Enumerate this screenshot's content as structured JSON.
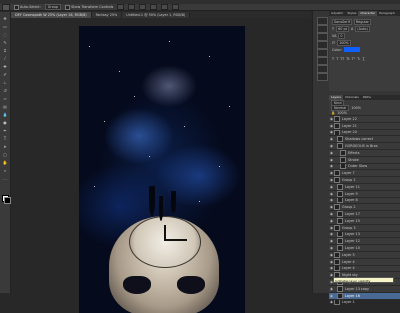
{
  "options_bar": {
    "auto_select_label": "Auto-Select:",
    "auto_select_value": "Group",
    "show_transform_label": "Show Transform Controls"
  },
  "doc_tabs": [
    {
      "label": "DEY Cosmopath W 25% (Layer 16, RGB/8)",
      "active": true
    },
    {
      "label": "Fantasy 25%",
      "active": false
    },
    {
      "label": "Untitled-1 @ 50% (Layer 1, RGB/8)",
      "active": false
    }
  ],
  "panel_tabs_top": [
    "Adjustm",
    "Styles",
    "Character",
    "Paragraph"
  ],
  "character": {
    "font_family": "SansSerif",
    "font_style": "Regular",
    "size": "60 pt",
    "leading": "(Auto)",
    "tracking": "0",
    "scale": "100%",
    "color_label": "Color:"
  },
  "layers_panel": {
    "tabs": [
      "Layers",
      "Channels",
      "Paths"
    ],
    "kind_label": "Kind",
    "blend_mode": "Normal",
    "opacity": "100%",
    "fill": "100%",
    "items": [
      {
        "name": "Layer 22",
        "indent": 0,
        "selected": false
      },
      {
        "name": "Layer 21",
        "indent": 0,
        "selected": false
      },
      {
        "name": "Layer 20",
        "indent": 0,
        "selected": false
      },
      {
        "name": "Shadows correct",
        "indent": 1,
        "selected": false
      },
      {
        "name": "GORGEOUS in Bros",
        "indent": 1,
        "selected": false
      },
      {
        "name": "Effects",
        "indent": 2,
        "selected": false
      },
      {
        "name": "Stroke",
        "indent": 2,
        "selected": false
      },
      {
        "name": "Outer Glow",
        "indent": 2,
        "selected": false
      },
      {
        "name": "Layer 7",
        "indent": 0,
        "selected": false
      },
      {
        "name": "Group 1",
        "indent": 0,
        "selected": false
      },
      {
        "name": "Layer 11",
        "indent": 1,
        "selected": false
      },
      {
        "name": "Layer 9",
        "indent": 1,
        "selected": false
      },
      {
        "name": "Layer 8",
        "indent": 1,
        "selected": false
      },
      {
        "name": "Group 2",
        "indent": 0,
        "selected": false
      },
      {
        "name": "Layer 17",
        "indent": 1,
        "selected": false
      },
      {
        "name": "Layer 15",
        "indent": 1,
        "selected": false
      },
      {
        "name": "Group 3",
        "indent": 0,
        "selected": false
      },
      {
        "name": "Layer 13",
        "indent": 1,
        "selected": false
      },
      {
        "name": "Layer 12",
        "indent": 1,
        "selected": false
      },
      {
        "name": "Layer 10",
        "indent": 1,
        "selected": false
      },
      {
        "name": "Layer 5",
        "indent": 0,
        "selected": false
      },
      {
        "name": "Layer 4",
        "indent": 0,
        "selected": false
      },
      {
        "name": "Layer 4",
        "indent": 0,
        "selected": false
      },
      {
        "name": "Night sky",
        "indent": 0,
        "selected": false
      },
      {
        "name": "Layer 17 copy",
        "indent": 1,
        "selected": false
      },
      {
        "name": "Layer 13 copy",
        "indent": 1,
        "selected": false
      },
      {
        "name": "Layer 16",
        "indent": 1,
        "selected": true
      },
      {
        "name": "Layer 1",
        "indent": 0,
        "selected": false
      }
    ]
  },
  "tooltip": "Indicates layer visibility",
  "colors": {
    "accent_blue": "#1060ff",
    "selection": "#4a6a95"
  }
}
